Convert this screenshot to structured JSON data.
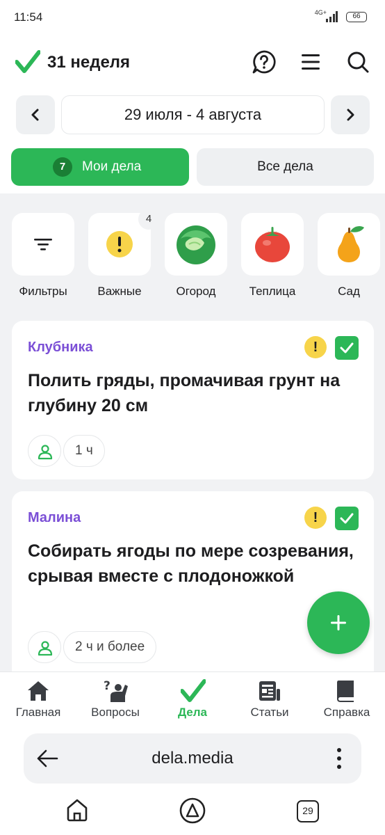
{
  "status_bar": {
    "time": "11:54",
    "network": "4G+",
    "battery": "66"
  },
  "header": {
    "title": "31 неделя",
    "icons": [
      "help-icon",
      "menu-icon",
      "search-icon"
    ]
  },
  "date_nav": {
    "range": "29 июля - 4 августа"
  },
  "tabs": {
    "mine": {
      "label": "Мои дела",
      "count": "7"
    },
    "all": {
      "label": "Все дела"
    }
  },
  "categories": [
    {
      "label": "Фильтры",
      "icon": "filter-icon"
    },
    {
      "label": "Важные",
      "icon": "important-icon",
      "count": "4"
    },
    {
      "label": "Огород",
      "icon": "cabbage-icon"
    },
    {
      "label": "Теплица",
      "icon": "tomato-icon"
    },
    {
      "label": "Сад",
      "icon": "pear-icon"
    }
  ],
  "tasks": [
    {
      "category": "Клубника",
      "text": "Полить гряды, промачивая грунт на глубину 20 см",
      "time": "1 ч"
    },
    {
      "category": "Малина",
      "text": "Собирать ягоды по мере созревания, срывая вместе с плодоножкой",
      "time": "2 ч и более"
    }
  ],
  "bottom_nav": [
    {
      "label": "Главная",
      "icon": "home-icon"
    },
    {
      "label": "Вопросы",
      "icon": "questions-icon"
    },
    {
      "label": "Дела",
      "icon": "tasks-icon",
      "active": true
    },
    {
      "label": "Статьи",
      "icon": "articles-icon"
    },
    {
      "label": "Справка",
      "icon": "book-icon"
    }
  ],
  "browser": {
    "url": "dela.media",
    "tab_count": "29"
  },
  "colors": {
    "accent": "#2cb757",
    "category": "#7b4fd6",
    "important": "#f7d44a"
  }
}
